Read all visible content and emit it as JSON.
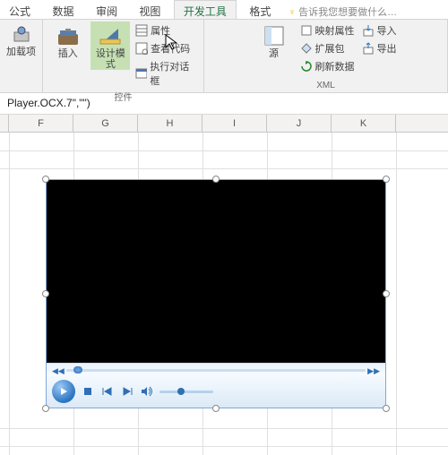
{
  "tabs": {
    "formula": "公式",
    "data": "数据",
    "review": "审阅",
    "view": "视图",
    "developer": "开发工具",
    "format": "格式"
  },
  "tell_me": "告诉我您想要做什么…",
  "groups": {
    "addins": {
      "btn": "加载项",
      "label": ""
    },
    "insert": {
      "btn": "插入",
      "label": ""
    },
    "design_mode": "设计模式",
    "controls": {
      "properties": "属性",
      "view_code": "查看代码",
      "run_dialog": "执行对话框",
      "label": "控件"
    },
    "source": {
      "btn": "源"
    },
    "xml": {
      "map_props": "映射属性",
      "expansion": "扩展包",
      "refresh": "刷新数据",
      "import_": "导入",
      "export_": "导出",
      "label": "XML"
    }
  },
  "formula_bar": "Player.OCX.7\",\"\")",
  "columns": [
    "F",
    "G",
    "H",
    "I",
    "J",
    "K"
  ]
}
